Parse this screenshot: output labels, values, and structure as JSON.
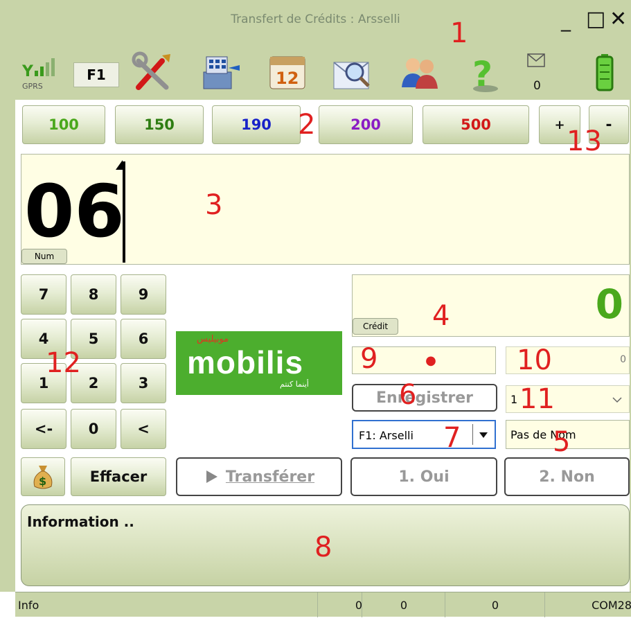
{
  "window": {
    "title": "Transfert de Crédits : Arsselli",
    "minimize_label": "_",
    "maximize_label": "□",
    "close_label": "✕"
  },
  "toolbar": {
    "signal_label": "GPRS",
    "f1_label": "F1",
    "mail_count": "0",
    "icons": [
      "signal-icon",
      "tools-icon",
      "cash-register-icon",
      "calendar-icon",
      "mail-search-icon",
      "users-icon",
      "help-icon",
      "mail-icon",
      "battery-icon"
    ]
  },
  "amounts": [
    {
      "label": "100",
      "color": "#4aa81c"
    },
    {
      "label": "150",
      "color": "#2e7d12"
    },
    {
      "label": "190",
      "color": "#1822c8"
    },
    {
      "label": "200",
      "color": "#8a1cc4"
    },
    {
      "label": "500",
      "color": "#d21818"
    }
  ],
  "plus_label": "+",
  "minus_label": "-",
  "number_display": {
    "value": "06",
    "mode_label": "Num"
  },
  "keypad": {
    "rows": [
      [
        "7",
        "8",
        "9"
      ],
      [
        "4",
        "5",
        "6"
      ],
      [
        "1",
        "2",
        "3"
      ],
      [
        "<-",
        "0",
        "<"
      ]
    ]
  },
  "clear_label": "Effacer",
  "logo": {
    "brand": "mobilis",
    "arabic_top": "موبيليس",
    "arabic_bottom": "أينما كنتم"
  },
  "credit": {
    "value": "0",
    "label": "Crédit"
  },
  "field9_dot": "●",
  "field10_value": "0",
  "save_label": "Enregistrer",
  "select11_value": "1",
  "operator_select": "F1: Arselli",
  "name_field": "Pas de Nom",
  "transfer_label": "Transférer",
  "yes_label": "1. Oui",
  "no_label": "2. Non",
  "info": {
    "title": "Information .."
  },
  "statusbar": {
    "info": "Info",
    "c1": "0",
    "c2": "0",
    "c3": "0",
    "port": "COM28"
  },
  "annotations": [
    "1",
    "2",
    "3",
    "4",
    "5",
    "6",
    "7",
    "8",
    "9",
    "10",
    "11",
    "12",
    "13"
  ],
  "colors": {
    "panel": "#c8d4a8",
    "input_bg": "#fffee4",
    "credit_green": "#4aa81c",
    "mobilis_green": "#4cae2e",
    "annotation_red": "#e02020"
  }
}
